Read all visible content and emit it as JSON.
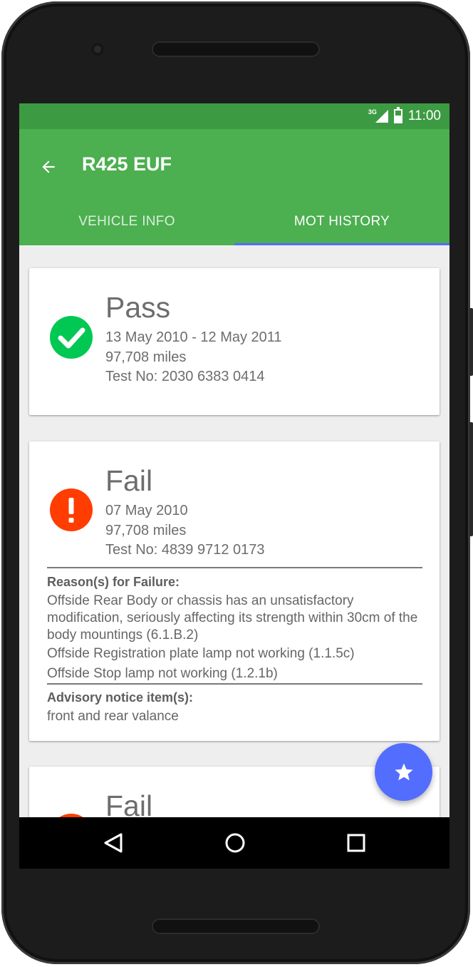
{
  "status_bar": {
    "network": "3G",
    "time": "11:00"
  },
  "app_bar": {
    "title": "R425 EUF",
    "tabs": [
      {
        "label": "VEHICLE INFO",
        "active": false
      },
      {
        "label": "MOT HISTORY",
        "active": true
      }
    ]
  },
  "records": [
    {
      "result": "Pass",
      "date": "13 May 2010 - 12 May 2011",
      "mileage": "97,708 miles",
      "test_no": "Test No: 2030 6383 0414",
      "icon": "check-circle-icon",
      "color": "#00c853"
    },
    {
      "result": "Fail",
      "date": "07 May 2010",
      "mileage": "97,708 miles",
      "test_no": "Test No: 4839 9712 0173",
      "icon": "alert-circle-icon",
      "color": "#ff3d00",
      "failure_heading": "Reason(s) for Failure:",
      "failures": [
        "Offside Rear Body or chassis has an unsatisfactory modification, seriously affecting its strength within 30cm of the body mountings (6.1.B.2)",
        "Offside Registration plate lamp not working (1.1.5c)",
        "Offside Stop lamp not working (1.2.1b)"
      ],
      "advisory_heading": "Advisory notice item(s):",
      "advisories": [
        "front and rear valance"
      ]
    },
    {
      "result": "Fail",
      "icon": "alert-circle-icon",
      "color": "#ff3d00"
    }
  ],
  "fab": {
    "icon": "star-icon",
    "color": "#536dfe"
  },
  "colors": {
    "primary": "#4caf50",
    "primary_dark": "#3c9b42",
    "accent": "#536dfe"
  },
  "nav": {
    "back_icon": "triangle-back-icon",
    "home_icon": "circle-home-icon",
    "recents_icon": "square-recents-icon"
  }
}
